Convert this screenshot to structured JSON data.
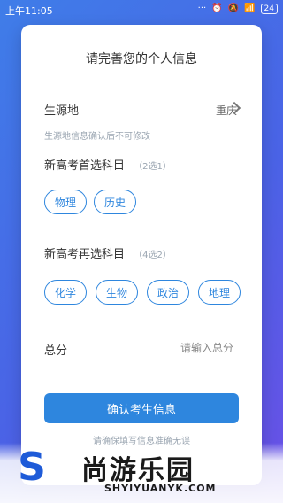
{
  "status_bar": {
    "time": "上午11:05",
    "battery": "24"
  },
  "form": {
    "title": "请完善您的个人信息",
    "origin": {
      "label": "生源地",
      "value": "重庆",
      "hint": "生源地信息确认后不可修改"
    },
    "first_choice": {
      "title": "新高考首选科目",
      "subtitle": "（2选1）",
      "options": [
        "物理",
        "历史"
      ]
    },
    "second_choice": {
      "title": "新高考再选科目",
      "subtitle": "（4选2）",
      "options": [
        "化学",
        "生物",
        "政治",
        "地理"
      ]
    },
    "score": {
      "label": "总分",
      "placeholder": "请输入总分"
    },
    "confirm_button": "确认考生信息",
    "note": "请确保填写信息准确无误"
  },
  "branding": {
    "name": "尚游乐园",
    "domain": "SHYIYUANYK.COM"
  }
}
